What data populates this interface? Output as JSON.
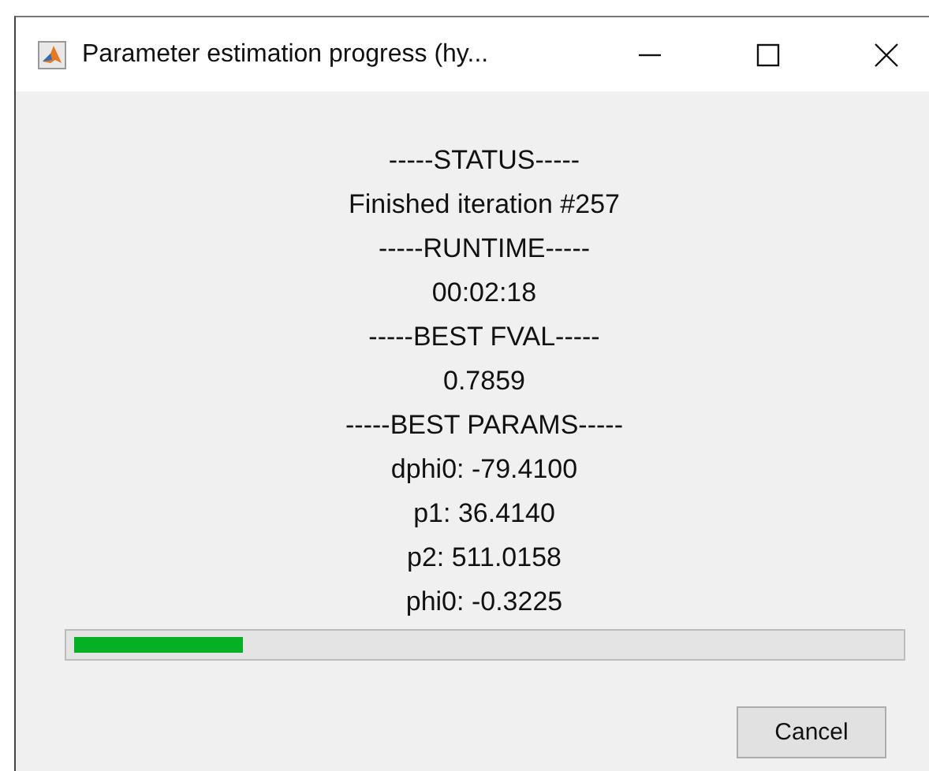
{
  "window": {
    "title": "Parameter estimation progress (hy..."
  },
  "lines": [
    "-----STATUS-----",
    "Finished iteration #257",
    "-----RUNTIME-----",
    "00:02:18",
    "-----BEST FVAL-----",
    "0.7859",
    "-----BEST PARAMS-----",
    "dphi0: -79.4100",
    "p1: 36.4140",
    "p2: 511.0158",
    "phi0: -0.3225"
  ],
  "progress": {
    "level": 0.205
  },
  "buttons": [
    "Cancel"
  ]
}
